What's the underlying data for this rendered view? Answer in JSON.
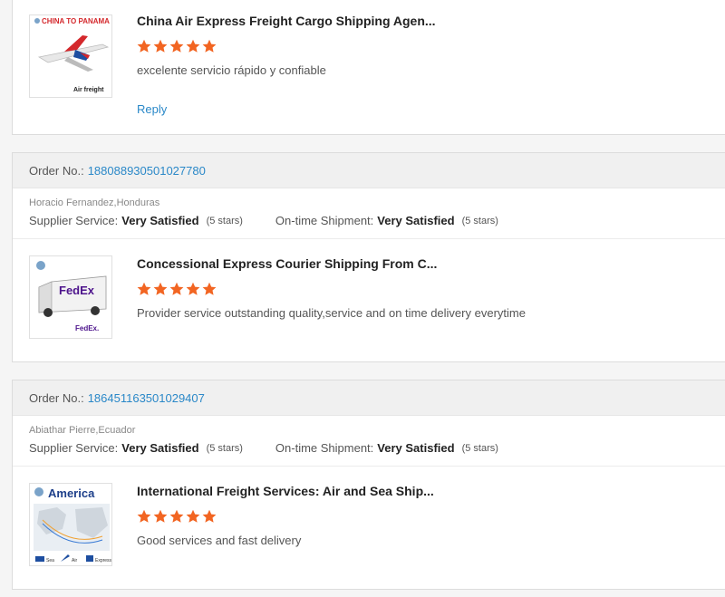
{
  "reviews": [
    {
      "product_title": "China Air Express Freight Cargo Shipping Agen...",
      "comment": "excelente servicio rápido y confiable",
      "reply_label": "Reply",
      "thumb": {
        "top_text": "CHINA TO PANAMA",
        "bottom_text": "Air freight"
      }
    },
    {
      "order_label": "Order No.:",
      "order_number": "188088930501027780",
      "buyer": "Horacio Fernandez,Honduras",
      "supplier_label": "Supplier Service:",
      "supplier_value": "Very Satisfied",
      "supplier_stars": "(5 stars)",
      "shipment_label": "On-time Shipment:",
      "shipment_value": "Very Satisfied",
      "shipment_stars": "(5 stars)",
      "product_title": "Concessional Express Courier Shipping From C...",
      "comment": "Provider service outstanding quality,service and on time delivery everytime",
      "thumb": {
        "logo_text": "FedEx",
        "bottom_text": "FedEx."
      }
    },
    {
      "order_label": "Order No.:",
      "order_number": "186451163501029407",
      "buyer": "Abiathar Pierre,Ecuador",
      "supplier_label": "Supplier Service:",
      "supplier_value": "Very Satisfied",
      "supplier_stars": "(5 stars)",
      "shipment_label": "On-time Shipment:",
      "shipment_value": "Very Satisfied",
      "shipment_stars": "(5 stars)",
      "product_title": "International Freight Services: Air and Sea Ship...",
      "comment": "Good services and fast delivery",
      "thumb": {
        "top_text": "America",
        "legend": [
          "Sea",
          "Air",
          "Express"
        ]
      }
    }
  ],
  "rating": {
    "stars": 5,
    "max": 5,
    "color": "#f26522"
  },
  "colors": {
    "link": "#2a88c8",
    "star": "#f26522"
  }
}
